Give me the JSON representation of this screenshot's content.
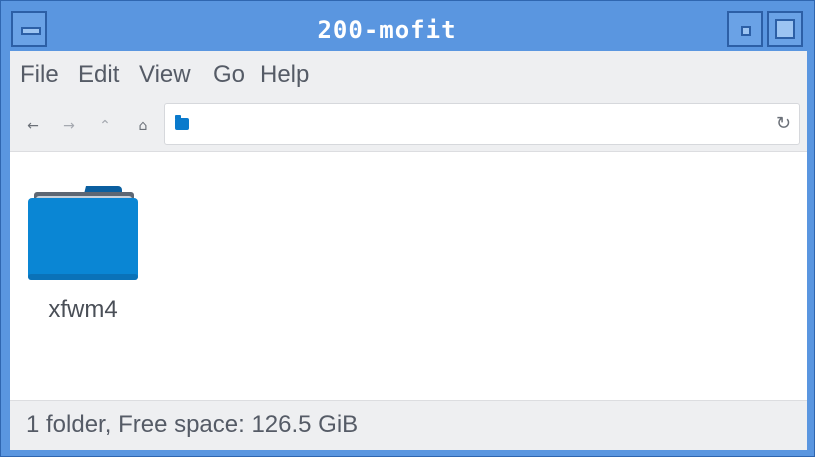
{
  "window": {
    "title": "200-mofit"
  },
  "menubar": {
    "items": [
      "File",
      "Edit",
      "View",
      "Go",
      "Help"
    ]
  },
  "toolbar": {
    "back_icon": "arrow-left-icon",
    "forward_icon": "arrow-right-icon",
    "up_icon": "arrow-up-icon",
    "home_icon": "home-icon",
    "location_icon": "folder-icon",
    "location_value": "",
    "reload_icon": "reload-icon"
  },
  "files": [
    {
      "name": "xfwm4",
      "icon": "folder-icon"
    }
  ],
  "status": {
    "text": "1 folder, Free space: 126.5 GiB"
  },
  "colors": {
    "titlebar": "#5a96e0",
    "folder": "#0a7acc"
  }
}
